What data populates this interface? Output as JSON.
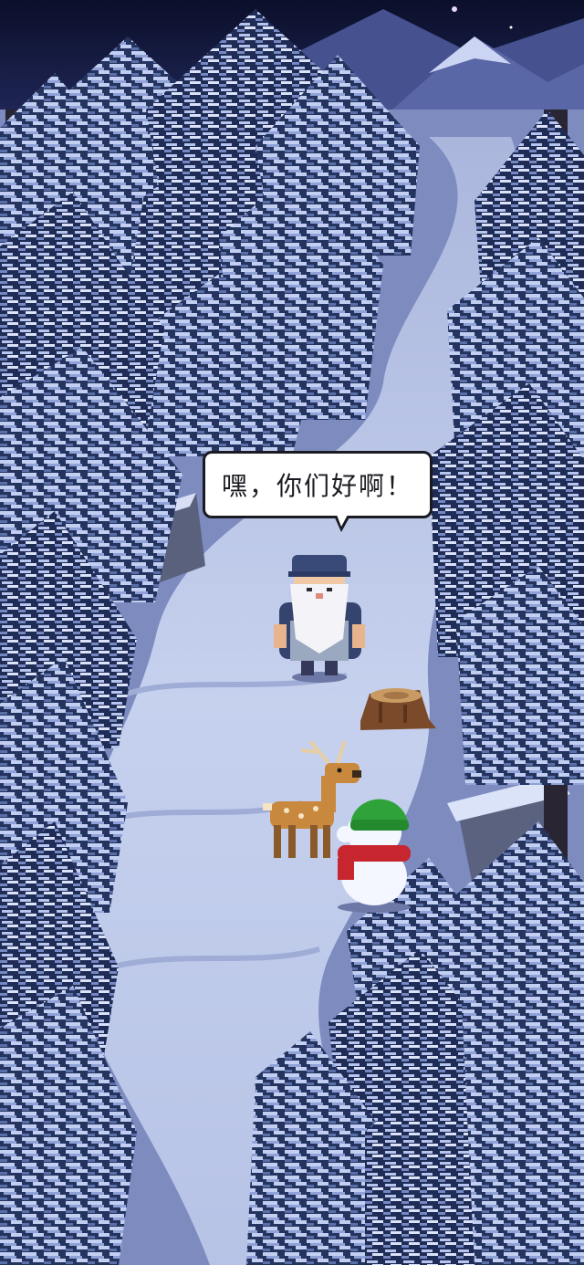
{
  "dialogue": {
    "text": "嘿，你们好啊！"
  },
  "scene": {
    "setting": "snowy-pine-forest-night",
    "characters": [
      "old-man-npc",
      "deer",
      "snowman"
    ],
    "props": [
      "tree-stump"
    ]
  },
  "colors": {
    "sky": "#0e1330",
    "snow_path": "#c9d4ec",
    "snow_shadow": "#9aa7d2",
    "pine_dark": "#1d2a52",
    "pine_snow": "#b8c6ee",
    "bubble_bg": "#ffffff",
    "bubble_border": "#1a1a22"
  }
}
